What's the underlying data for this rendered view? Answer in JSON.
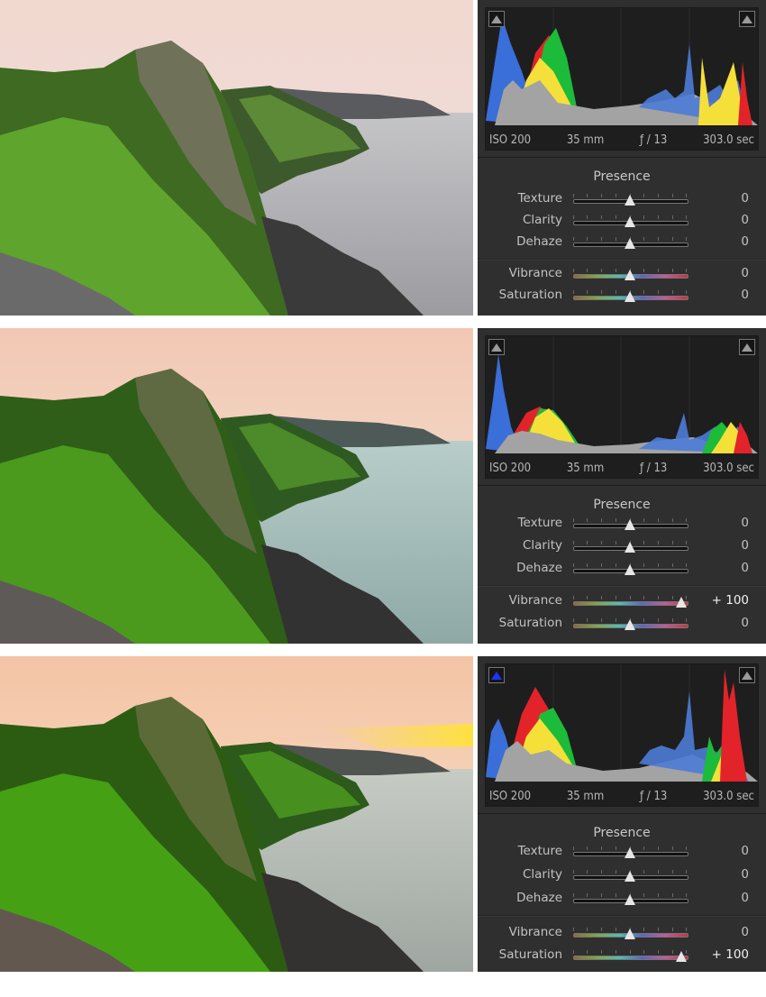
{
  "panels": [
    {
      "histogram": {
        "shadow_clip": "off",
        "highlight_clip": "off",
        "iso": "ISO 200",
        "focal": "35 mm",
        "aperture": "ƒ / 13",
        "shutter": "303.0 sec"
      },
      "presence": {
        "title": "Presence",
        "texture": {
          "label": "Texture",
          "value": "0",
          "level": 0
        },
        "clarity": {
          "label": "Clarity",
          "value": "0",
          "level": 0
        },
        "dehaze": {
          "label": "Dehaze",
          "value": "0",
          "level": 0
        },
        "vibrance": {
          "label": "Vibrance",
          "value": "0",
          "level": 0
        },
        "saturation": {
          "label": "Saturation",
          "value": "0",
          "level": 0
        }
      }
    },
    {
      "histogram": {
        "shadow_clip": "off",
        "highlight_clip": "off",
        "iso": "ISO 200",
        "focal": "35 mm",
        "aperture": "ƒ / 13",
        "shutter": "303.0 sec"
      },
      "presence": {
        "title": "Presence",
        "texture": {
          "label": "Texture",
          "value": "0",
          "level": 0
        },
        "clarity": {
          "label": "Clarity",
          "value": "0",
          "level": 0
        },
        "dehaze": {
          "label": "Dehaze",
          "value": "0",
          "level": 0
        },
        "vibrance": {
          "label": "Vibrance",
          "value": "+ 100",
          "level": 100
        },
        "saturation": {
          "label": "Saturation",
          "value": "0",
          "level": 0
        }
      }
    },
    {
      "histogram": {
        "shadow_clip": "on",
        "highlight_clip": "off",
        "iso": "ISO 200",
        "focal": "35 mm",
        "aperture": "ƒ / 13",
        "shutter": "303.0 sec"
      },
      "presence": {
        "title": "Presence",
        "texture": {
          "label": "Texture",
          "value": "0",
          "level": 0
        },
        "clarity": {
          "label": "Clarity",
          "value": "0",
          "level": 0
        },
        "dehaze": {
          "label": "Dehaze",
          "value": "0",
          "level": 0
        },
        "vibrance": {
          "label": "Vibrance",
          "value": "0",
          "level": 0
        },
        "saturation": {
          "label": "Saturation",
          "value": "+ 100",
          "level": 100
        }
      }
    }
  ],
  "colors": {
    "panel_bg": "#2f2f2f",
    "histogram_bg": "#1e1e1e",
    "clip_active": "#1c34ff"
  }
}
